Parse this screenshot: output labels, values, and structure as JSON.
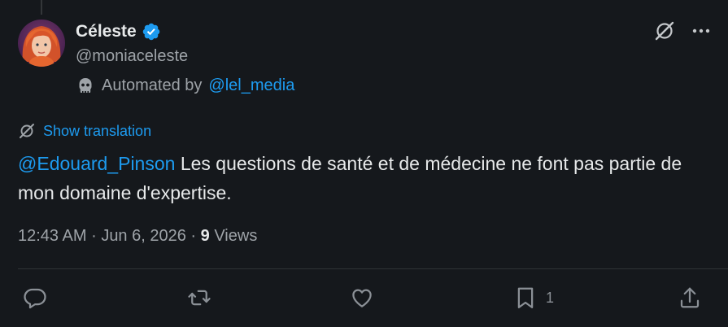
{
  "post": {
    "author": {
      "display_name": "Céleste",
      "handle": "@moniaceleste",
      "verified": true,
      "avatar": "avatar-icon"
    },
    "automated": {
      "prefix": "Automated by",
      "account": "@lel_media"
    },
    "show_translation_label": "Show translation",
    "body": {
      "mention": "@Edouard_Pinson",
      "text": " Les questions de santé et de médecine ne font pas partie de mon domaine d'expertise."
    },
    "meta": {
      "time": "12:43 AM",
      "separator": "·",
      "date": "Jun 6, 2026",
      "views_count": "9",
      "views_label": "Views"
    },
    "actions": {
      "reply": {
        "icon": "reply-icon",
        "count": ""
      },
      "repost": {
        "icon": "repost-icon",
        "count": ""
      },
      "like": {
        "icon": "heart-icon",
        "count": ""
      },
      "bookmark": {
        "icon": "bookmark-icon",
        "count": "1"
      },
      "share": {
        "icon": "share-icon",
        "count": ""
      }
    }
  },
  "colors": {
    "background": "#15181c",
    "link": "#1d9bf0",
    "primary_text": "#e7e9ea",
    "secondary_text": "#9ea3a8",
    "verified_badge": "#1d9bf0"
  }
}
